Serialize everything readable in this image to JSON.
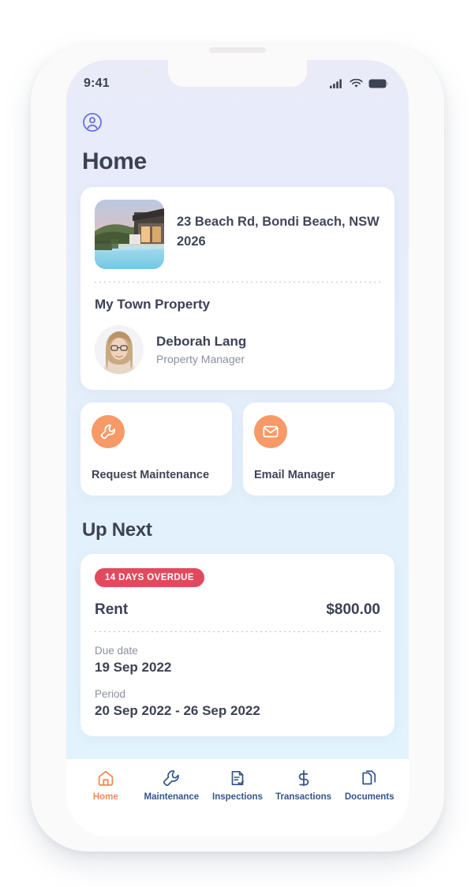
{
  "statusbar": {
    "time": "9:41",
    "icons": [
      "cellular-signal-icon",
      "wifi-icon",
      "battery-icon"
    ]
  },
  "header": {
    "profile_icon": "user-circle-icon",
    "title": "Home"
  },
  "property": {
    "thumbnail_alt": "property-photo-house-with-pool",
    "address": "23 Beach Rd, Bondi Beach, NSW 2026",
    "agency_name": "My Town Property",
    "manager": {
      "avatar_alt": "manager-portrait",
      "name": "Deborah Lang",
      "role": "Property Manager"
    }
  },
  "actions": [
    {
      "icon": "wrench-icon",
      "label": "Request Maintenance",
      "color": "#f79a68"
    },
    {
      "icon": "envelope-icon",
      "label": "Email Manager",
      "color": "#f79a68"
    }
  ],
  "up_next": {
    "section_title": "Up Next",
    "badge": "14 DAYS OVERDUE",
    "badge_color": "#e2495e",
    "item_label": "Rent",
    "amount": "$800.00",
    "details": [
      {
        "label": "Due date",
        "value": "19 Sep 2022"
      },
      {
        "label": "Period",
        "value": "20 Sep 2022 - 26 Sep 2022"
      }
    ]
  },
  "bottom_nav": {
    "active_color": "#f08b52",
    "inactive_color": "#34558b",
    "items": [
      {
        "icon": "home-icon",
        "label": "Home",
        "active": true
      },
      {
        "icon": "wrench-icon",
        "label": "Maintenance",
        "active": false
      },
      {
        "icon": "clipboard-check-icon",
        "label": "Inspections",
        "active": false
      },
      {
        "icon": "dollar-sign-icon",
        "label": "Transactions",
        "active": false
      },
      {
        "icon": "documents-icon",
        "label": "Documents",
        "active": false
      }
    ]
  }
}
